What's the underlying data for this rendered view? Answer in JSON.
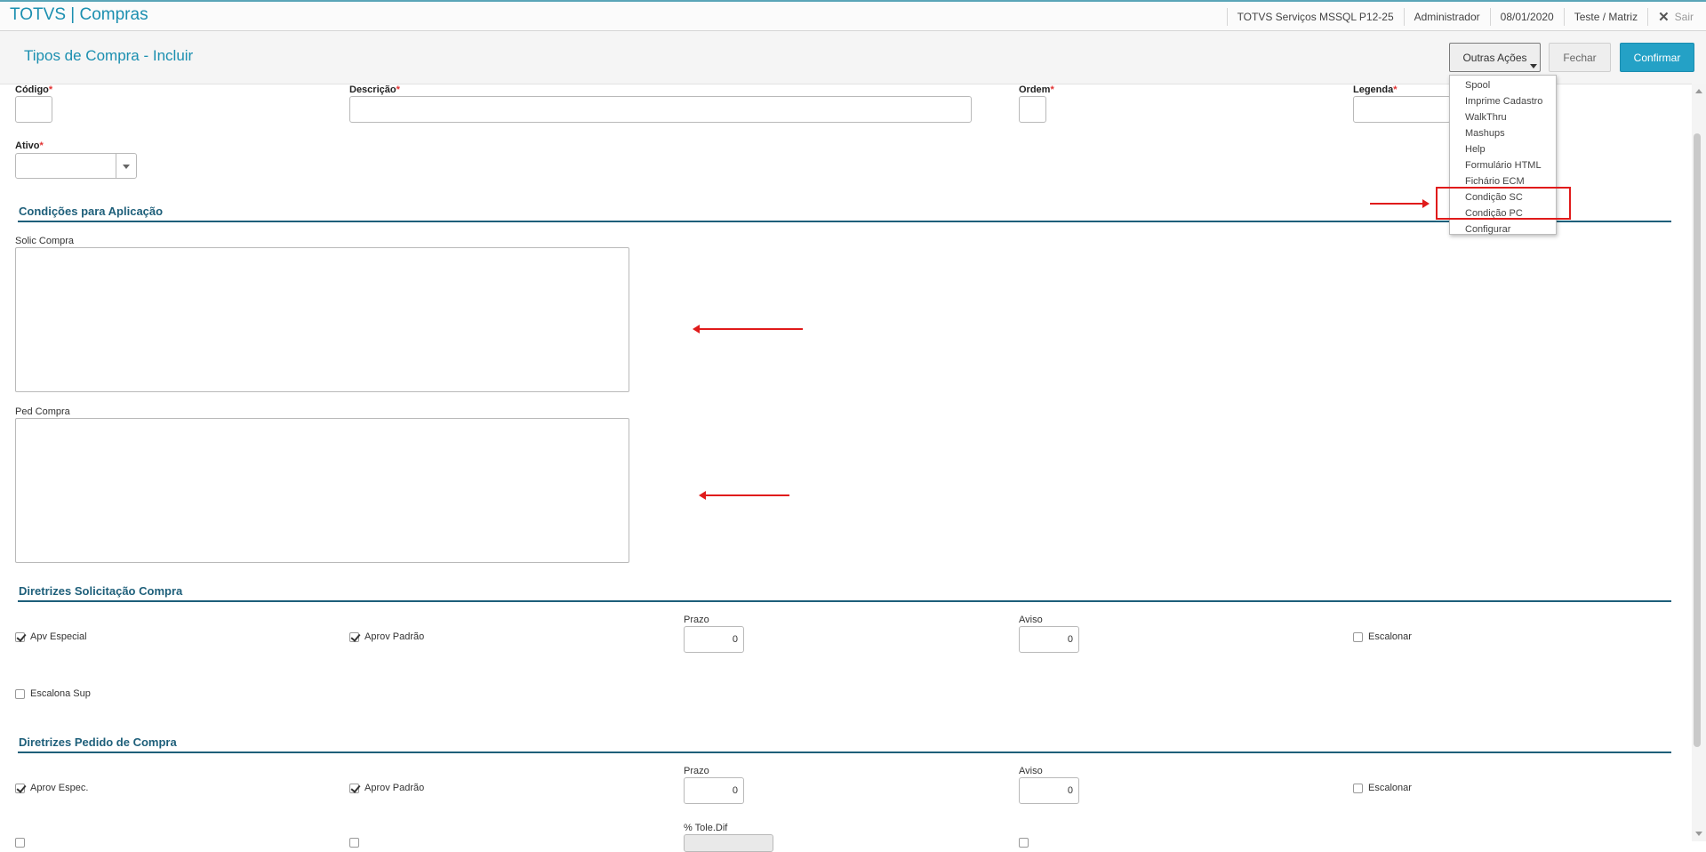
{
  "topbar": {
    "app_title": "TOTVS | Compras",
    "server": "TOTVS Serviços MSSQL P12-25",
    "user": "Administrador",
    "date": "08/01/2020",
    "branch": "Teste / Matriz",
    "logout_label": "Sair"
  },
  "header": {
    "title": "Tipos de Compra - Incluir",
    "other_actions_label": "Outras Ações",
    "close_label": "Fechar",
    "confirm_label": "Confirmar"
  },
  "form": {
    "codigo_label": "Código",
    "descricao_label": "Descrição",
    "ordem_label": "Ordem",
    "legenda_label": "Legenda",
    "ativo_label": "Ativo",
    "required_mark": "*",
    "codigo_value": "",
    "descricao_value": "",
    "ordem_value": "",
    "legenda_value": "",
    "ativo_value": ""
  },
  "section_conditions": {
    "title": "Condições para Aplicação",
    "solic_label": "Solic Compra",
    "ped_label": "Ped Compra",
    "solic_value": "",
    "ped_value": ""
  },
  "section_sc": {
    "title": "Diretrizes Solicitação Compra",
    "apv_especial": {
      "label": "Apv Especial",
      "checked": true
    },
    "aprov_padrao": {
      "label": "Aprov Padrão",
      "checked": true
    },
    "prazo_label": "Prazo",
    "prazo_value": "0",
    "aviso_label": "Aviso",
    "aviso_value": "0",
    "escalonar": {
      "label": "Escalonar",
      "checked": false
    },
    "escalona_sup": {
      "label": "Escalona Sup",
      "checked": false
    }
  },
  "section_pc": {
    "title": "Diretrizes Pedido de Compra",
    "aprov_espec": {
      "label": "Aprov Espec.",
      "checked": true
    },
    "aprov_padrao": {
      "label": "Aprov Padrão",
      "checked": true
    },
    "prazo_label": "Prazo",
    "prazo_value": "0",
    "aviso_label": "Aviso",
    "aviso_value": "0",
    "escalonar": {
      "label": "Escalonar",
      "checked": false
    },
    "tole_dif_label": "% Tole.Dif"
  },
  "menu": {
    "items": [
      "Spool",
      "Imprime Cadastro",
      "WalkThru",
      "Mashups",
      "Help",
      "Formulário HTML",
      "Fichário ECM",
      "Condição SC",
      "Condição PC",
      "Configurar"
    ]
  },
  "colors": {
    "accent": "#1b8fb0",
    "section": "#1e5f7a",
    "confirm_button": "#24a1c6",
    "annotation_red": "#e01b1b",
    "required": "#e23333"
  },
  "icons": {
    "logout": "close-icon",
    "dropdown": "chevron-down-icon",
    "checkbox": "check-icon"
  }
}
